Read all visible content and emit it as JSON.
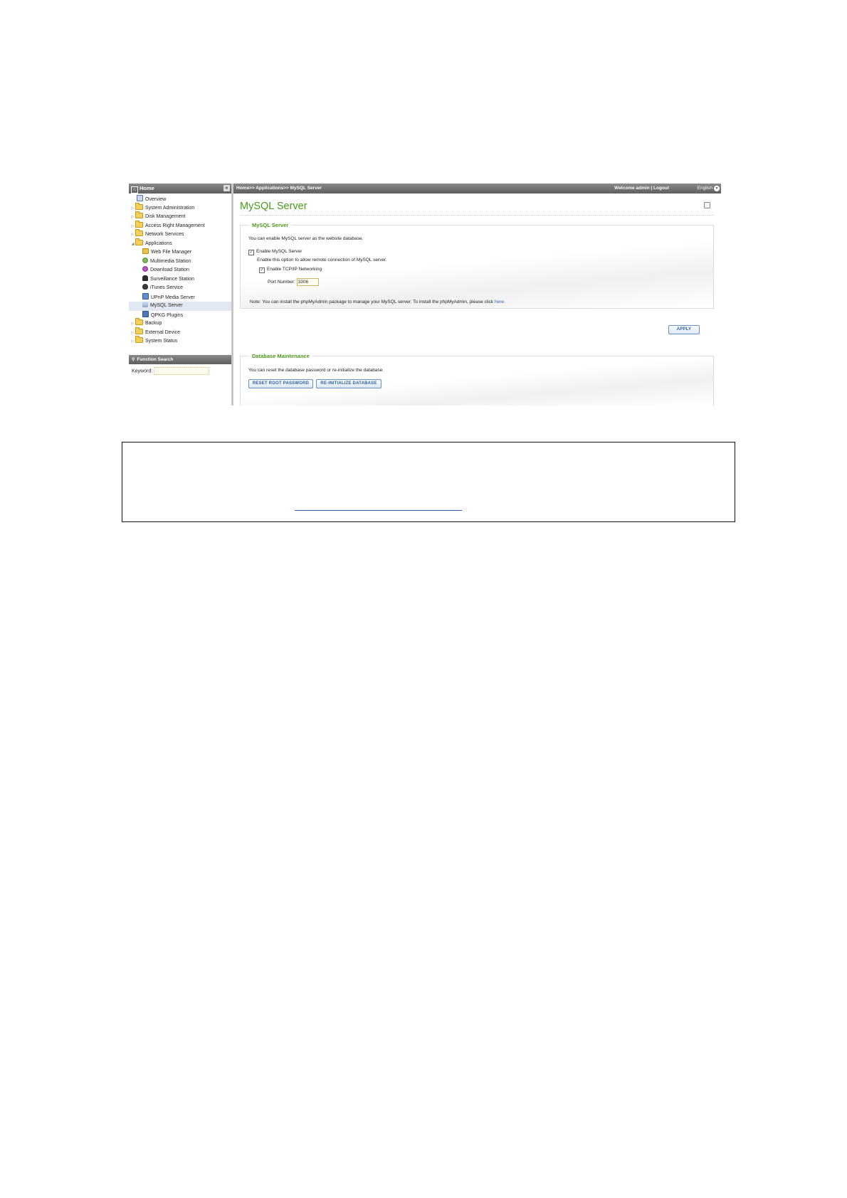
{
  "sidebar": {
    "header_title": "Home",
    "collapse_symbol": "«",
    "items": [
      {
        "label": "Overview",
        "icon": "overview-icon"
      },
      {
        "label": "System Administration",
        "icon": "folder-icon"
      },
      {
        "label": "Disk Management",
        "icon": "folder-icon"
      },
      {
        "label": "Access Right Management",
        "icon": "folder-icon"
      },
      {
        "label": "Network Services",
        "icon": "folder-icon"
      },
      {
        "label": "Applications",
        "icon": "folder-open-icon"
      }
    ],
    "sub_items": [
      {
        "label": "Web File Manager",
        "icon": "web-file-manager-icon"
      },
      {
        "label": "Multimedia Station",
        "icon": "multimedia-station-icon"
      },
      {
        "label": "Download Station",
        "icon": "download-station-icon"
      },
      {
        "label": "Surveillance Station",
        "icon": "surveillance-station-icon"
      },
      {
        "label": "iTunes Service",
        "icon": "itunes-service-icon"
      },
      {
        "label": "UPnP Media Server",
        "icon": "upnp-media-server-icon"
      },
      {
        "label": "MySQL Server",
        "icon": "mysql-server-icon",
        "selected": true
      },
      {
        "label": "QPKG Plugins",
        "icon": "qpkg-plugins-icon"
      }
    ],
    "bottom_items": [
      {
        "label": "Backup",
        "icon": "folder-icon"
      },
      {
        "label": "External Device",
        "icon": "folder-icon"
      },
      {
        "label": "System Status",
        "icon": "folder-icon"
      }
    ],
    "search_header": "Function Search",
    "keyword_label": "Keyword:"
  },
  "topbar": {
    "breadcrumb": "Home>> Applications>> MySQL Server",
    "welcome": "Welcome admin | Logout",
    "language": "English"
  },
  "page_title": "MySQL Server",
  "mysql_panel": {
    "title": "MySQL Server",
    "intro": "You can enable MySQL server as the website database.",
    "enable_label": "Enable MySQL Server",
    "enable_checked": true,
    "remote_text": "Enable this option to allow remote connection of MySQL server.",
    "tcpip_label": "Enable TCP/IP Networking",
    "tcpip_checked": true,
    "port_label": "Port Number:",
    "port_value": "3306",
    "note_prefix": "Note: You can install the phpMyAdmin package to manage your MySQL server. To install the phpMyAdmin, please click ",
    "note_link": "here",
    "note_suffix": "."
  },
  "apply_label": "APPLY",
  "db_panel": {
    "title": "Database Maintenance",
    "intro": "You can reset the database password or re-initialize the database.",
    "reset_label": "RESET ROOT PASSWORD",
    "reinit_label": "RE-INITIALIZE DATABASE"
  }
}
